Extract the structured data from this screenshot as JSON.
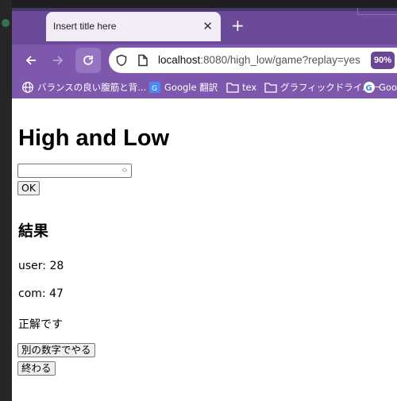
{
  "browser": {
    "tab_title": "Insert title here",
    "new_tab_symbol": "+",
    "url_host": "localhost",
    "url_path": ":8080/high_low/game?replay=yes",
    "zoom": "90%",
    "bookmarks": [
      {
        "label": "バランスの良い腹筋と背...",
        "icon": "globe-icon"
      },
      {
        "label": "Google 翻訳",
        "icon": "google-translate-icon"
      },
      {
        "label": "tex",
        "icon": "folder-icon"
      },
      {
        "label": "グラフィックドライバー",
        "icon": "folder-icon"
      },
      {
        "label": "Goo",
        "icon": "google-icon"
      }
    ]
  },
  "page": {
    "title": "High and Low",
    "number_value": "",
    "ok_label": "OK",
    "result_heading": "結果",
    "user_line": "user: 28",
    "com_line": "com: 47",
    "verdict": "正解です",
    "again_label": "別の数字でやる",
    "end_label": "終わる"
  }
}
